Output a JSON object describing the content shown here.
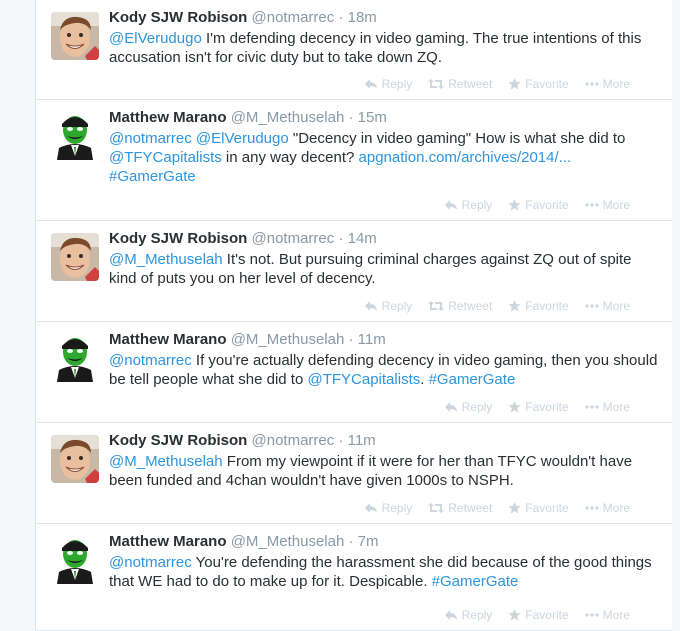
{
  "actions": {
    "reply": "Reply",
    "retweet": "Retweet",
    "favorite": "Favorite",
    "more": "More"
  },
  "tweets": [
    {
      "fullname": "Kody SJW Robison",
      "username": "@notmarrec",
      "time": "18m",
      "avatar": "smiling-man-avatar",
      "text": [
        {
          "t": "@ElVerudugo",
          "k": "mention"
        },
        {
          "t": " I'm defending decency in video gaming. The true intentions of this accusation isn't for civic duty but to take down ZQ.",
          "k": "plain"
        }
      ]
    },
    {
      "fullname": "Matthew Marano",
      "username": "@M_Methuselah",
      "time": "15m",
      "avatar": "green-masked-figure-avatar",
      "text": [
        {
          "t": "@notmarrec",
          "k": "mention"
        },
        {
          "t": " ",
          "k": "plain"
        },
        {
          "t": "@ElVerudugo",
          "k": "mention"
        },
        {
          "t": " \"Decency in video gaming\" How is what she did to ",
          "k": "plain"
        },
        {
          "t": "@TFYCapitalists",
          "k": "mention"
        },
        {
          "t": " in any way decent? ",
          "k": "plain"
        },
        {
          "t": "apgnation.com/archives/2014/...",
          "k": "link"
        },
        {
          "t": " ",
          "k": "plain"
        },
        {
          "t": "#GamerGate",
          "k": "hashtag"
        }
      ]
    },
    {
      "fullname": "Kody SJW Robison",
      "username": "@notmarrec",
      "time": "14m",
      "avatar": "smiling-man-avatar",
      "text": [
        {
          "t": "@M_Methuselah",
          "k": "mention"
        },
        {
          "t": " It's not. But pursuing criminal charges against ZQ out of spite kind of puts you on her level of decency.",
          "k": "plain"
        }
      ]
    },
    {
      "fullname": "Matthew Marano",
      "username": "@M_Methuselah",
      "time": "11m",
      "avatar": "green-masked-figure-avatar",
      "text": [
        {
          "t": "@notmarrec",
          "k": "mention"
        },
        {
          "t": " If you're actually defending decency in video gaming, then you should be tell people what she did to ",
          "k": "plain"
        },
        {
          "t": "@TFYCapitalists",
          "k": "mention"
        },
        {
          "t": ". ",
          "k": "plain"
        },
        {
          "t": "#GamerGate",
          "k": "hashtag"
        }
      ]
    },
    {
      "fullname": "Kody SJW Robison",
      "username": "@notmarrec",
      "time": "11m",
      "avatar": "smiling-man-avatar",
      "text": [
        {
          "t": "@M_Methuselah",
          "k": "mention"
        },
        {
          "t": " From my viewpoint if it were for her than TFYC wouldn't have been funded and 4chan wouldn't have given 1000s to NSPH.",
          "k": "plain"
        }
      ]
    },
    {
      "fullname": "Matthew Marano",
      "username": "@M_Methuselah",
      "time": "7m",
      "avatar": "green-masked-figure-avatar",
      "text": [
        {
          "t": "@notmarrec",
          "k": "mention"
        },
        {
          "t": " You're defending the harassment she did because of the good things that WE had to do to make up for it. Despicable. ",
          "k": "plain"
        },
        {
          "t": "#GamerGate",
          "k": "hashtag"
        }
      ]
    }
  ]
}
